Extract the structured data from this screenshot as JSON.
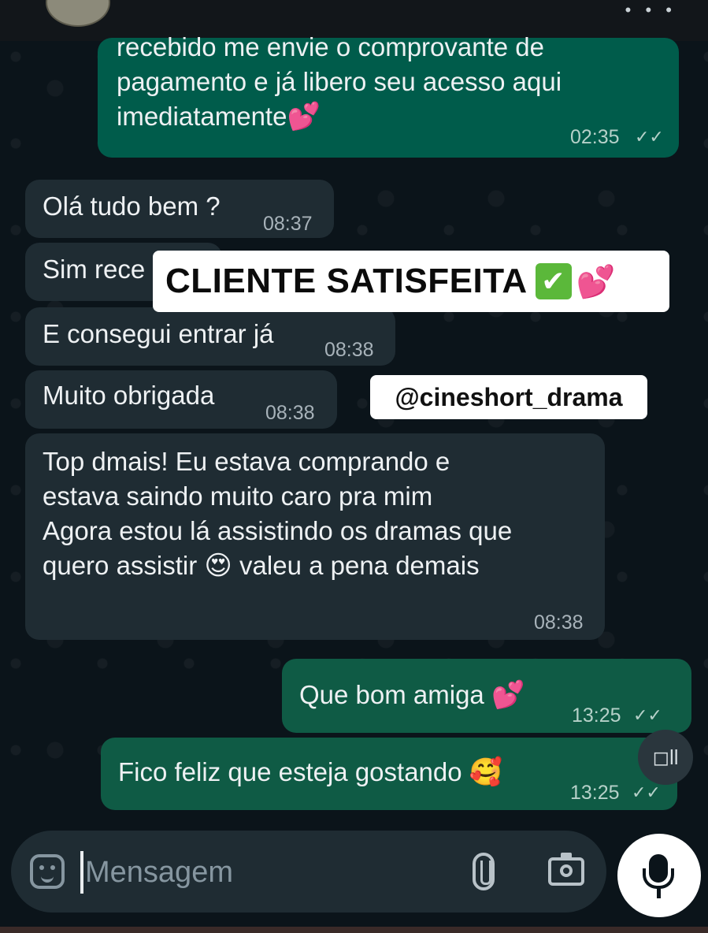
{
  "header": {
    "menu_label": "• • •"
  },
  "messages": [
    {
      "id": "m1",
      "dir": "out",
      "text": "recebido me envie o comprovante de\npagamento e já libero seu acesso aqui\nimediatamente",
      "emoji": "💕",
      "time": "02:35",
      "status": "read"
    },
    {
      "id": "m2",
      "dir": "in",
      "text": "Olá tudo bem ?",
      "time": "08:37"
    },
    {
      "id": "m3",
      "dir": "in",
      "text": "Sim rece",
      "time": ""
    },
    {
      "id": "m4",
      "dir": "in",
      "text": "E consegui entrar já",
      "time": "08:38"
    },
    {
      "id": "m5",
      "dir": "in",
      "text": "Muito obrigada",
      "time": "08:38"
    },
    {
      "id": "m6",
      "dir": "in",
      "text": "Top dmais! Eu estava comprando e\nestava saindo muito caro pra mim\nAgora estou lá assistindo os dramas que\nquero assistir",
      "emoji": "😍",
      "text_after": " valeu a pena demais",
      "time": "08:38"
    },
    {
      "id": "m7",
      "dir": "out",
      "text": "Que bom amiga ",
      "emoji": "💕",
      "time": "13:25",
      "status": "read"
    },
    {
      "id": "m8",
      "dir": "out",
      "text": "Fico feliz que esteja gostando ",
      "emoji": "🥰",
      "time": "13:25",
      "status": "read"
    }
  ],
  "overlays": {
    "title": "CLIENTE SATISFEITA",
    "title_check": "✔",
    "title_hearts": "💕",
    "handle": "@cineshort_drama"
  },
  "floating_button": {
    "label": "◻ll"
  },
  "composer": {
    "placeholder": "Mensagem"
  },
  "ticks_glyph": "✓✓",
  "colors": {
    "incoming": "#1f2c33",
    "outgoing": "#005c4b",
    "background": "#0b141a",
    "accent_check": "#5bb83a"
  }
}
